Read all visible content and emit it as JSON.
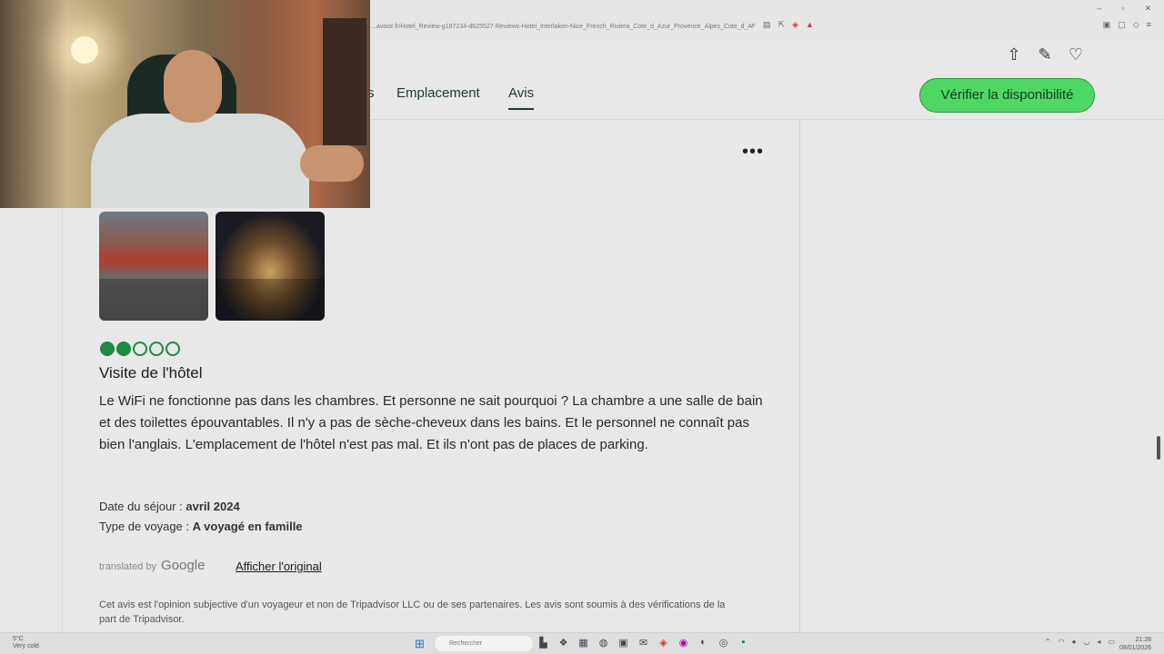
{
  "browser": {
    "url": "...avisor.fr/Hotel_Review-g187234-d625527-Reviews-Hotel_Interlaken-Nice_French_Riviera_Cote_d_Azur_Provence_Alpes_Cote_d_Azur.h...",
    "window_controls": [
      "–",
      "▫",
      "✕"
    ]
  },
  "header": {
    "icons": [
      "share-icon",
      "pencil-icon",
      "heart-icon"
    ]
  },
  "nav": {
    "partial_item": "s",
    "items": [
      "Emplacement",
      "Avis"
    ],
    "active": "Avis",
    "cta_label": "Vérifier la disponibilité"
  },
  "review": {
    "rating": 2,
    "rating_max": 5,
    "title": "Visite de l'hôtel",
    "text": "Le WiFi ne fonctionne pas dans les chambres. Et personne ne sait pourquoi ? La chambre a une salle de bain et des toilettes épouvantables. Il n'y a pas de sèche-cheveux dans les bains. Et le personnel ne connaît pas bien l'anglais. L'emplacement de l'hôtel n'est pas mal. Et ils n'ont pas de places de parking.",
    "stay_label": "Date du séjour :",
    "stay_value": "avril 2024",
    "trip_label": "Type de voyage :",
    "trip_value": "A voyagé en famille",
    "translated_by": "translated by",
    "google": "Google",
    "show_original": "Afficher l'original",
    "disclaimer": "Cet avis est l'opinion subjective d'un voyageur et non de Tripadvisor LLC ou de ses partenaires. Les avis sont soumis à des vérifications de la part de Tripadvisor."
  },
  "taskbar": {
    "weather_temp": "5°C",
    "weather_desc": "Very cold",
    "search_placeholder": "Rechercher",
    "time": "21:28",
    "date": "08/01/2026"
  },
  "colors": {
    "accent_green": "#4fd764",
    "rating_green": "#1e8a44",
    "nav_text": "#1c3b2b"
  }
}
